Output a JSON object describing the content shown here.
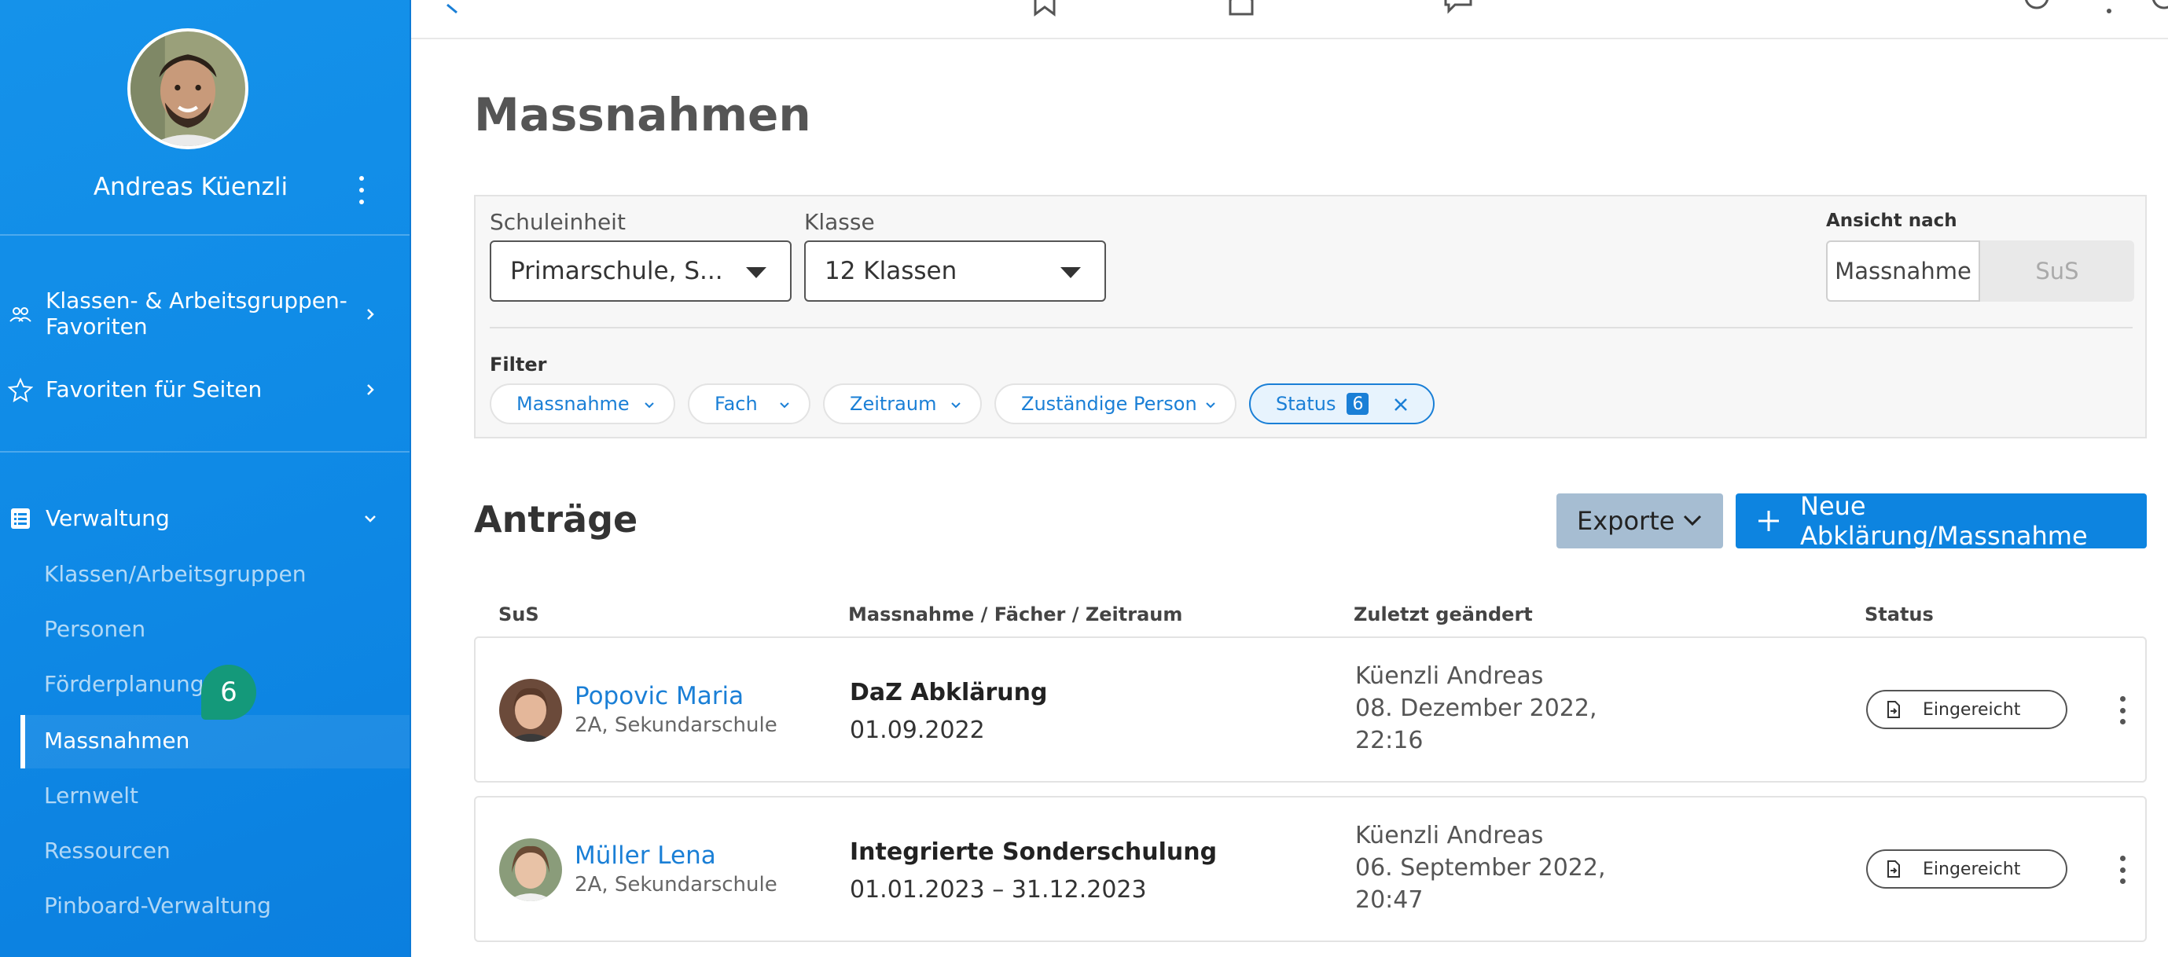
{
  "sidebar": {
    "user_name": "Andreas Küenzli",
    "favorites": [
      {
        "label": "Klassen- & Arbeitsgruppen-\nFavoriten",
        "icon": "users-icon"
      },
      {
        "label": "Favoriten für Seiten",
        "icon": "star-icon"
      }
    ],
    "section_label": "Verwaltung",
    "section_icon": "list-icon",
    "items": [
      {
        "label": "Klassen/Arbeitsgruppen"
      },
      {
        "label": "Personen"
      },
      {
        "label": "Förderplanung"
      },
      {
        "label": "Massnahmen",
        "active": true
      },
      {
        "label": "Lernwelt"
      },
      {
        "label": "Ressourcen"
      },
      {
        "label": "Pinboard-Verwaltung"
      }
    ],
    "badge": "6",
    "badge_color": "#14997a",
    "background": "#0f8ae6"
  },
  "page": {
    "title": "Massnahmen"
  },
  "filters": {
    "schuleinheit_label": "Schuleinheit",
    "schuleinheit_value": "Primarschule, S...",
    "klasse_label": "Klasse",
    "klasse_value": "12 Klassen",
    "view_label": "Ansicht nach",
    "view_options": [
      "Massnahme",
      "SuS"
    ],
    "filter_label": "Filter",
    "chips": [
      "Massnahme",
      "Fach",
      "Zeitraum",
      "Zuständige Person"
    ],
    "status_chip": {
      "label": "Status",
      "count": "6"
    }
  },
  "antraege": {
    "title": "Anträge",
    "export_label": "Exporte",
    "new_label": "Neue Abklärung/Massnahme",
    "columns": [
      "SuS",
      "Massnahme / Fächer / Zeitraum",
      "Zuletzt geändert",
      "Status"
    ],
    "rows": [
      {
        "name": "Popovic Maria",
        "sub": "2A, Sekundarschule",
        "measure": "DaZ Abklärung",
        "period": "01.09.2022",
        "changed_by": "Küenzli Andreas",
        "changed_date": "08. Dezember 2022,",
        "changed_time": "22:16",
        "status": "Eingereicht"
      },
      {
        "name": "Müller Lena",
        "sub": "2A, Sekundarschule",
        "measure": "Integrierte Sonderschulung",
        "period": "01.01.2023 – 31.12.2023",
        "changed_by": "Küenzli Andreas",
        "changed_date": "06. September 2022,",
        "changed_time": "20:47",
        "status": "Eingereicht"
      }
    ]
  },
  "colors": {
    "accent": "#1a7fd6",
    "primary_button": "#0d84e0",
    "export_button": "#a6bdd2"
  }
}
